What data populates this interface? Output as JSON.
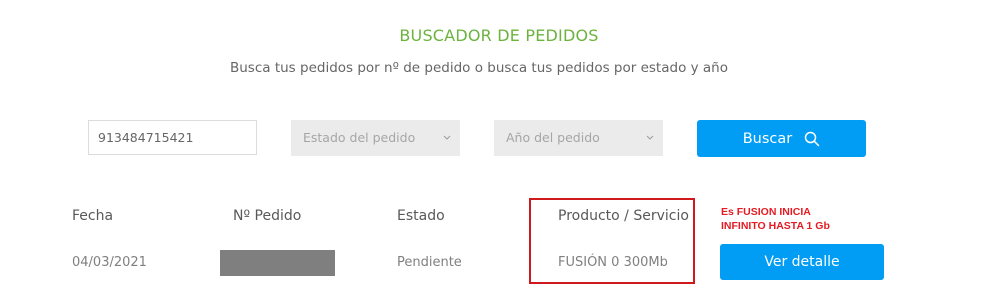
{
  "header": {
    "title": "BUSCADOR DE PEDIDOS",
    "subtitle": "Busca tus pedidos por nº de pedido o busca tus pedidos por estado y año"
  },
  "filters": {
    "order_number": {
      "value": "913484715421"
    },
    "status_select": {
      "selected": "Estado del pedido"
    },
    "year_select": {
      "selected": "Año del pedido"
    },
    "search_button": {
      "label": "Buscar",
      "icon": "search-icon"
    }
  },
  "table": {
    "columns": [
      "Fecha",
      "Nº Pedido",
      "Estado",
      "Producto / Servicio"
    ],
    "rows": [
      {
        "date": "04/03/2021",
        "order_number": "",
        "status": "Pendiente",
        "product": "FUSIÓN 0 300Mb",
        "action_label": "Ver detalle"
      }
    ]
  },
  "annotation": {
    "text": "Es FUSION INICIA\nINFINITO HASTA 1 Gb",
    "color": "#e31b23"
  },
  "colors": {
    "title": "#6cb33e",
    "primary": "#019df4",
    "select_bg": "#ebebeb",
    "redaction": "#7f7f7f",
    "highlight": "#d0191c"
  }
}
